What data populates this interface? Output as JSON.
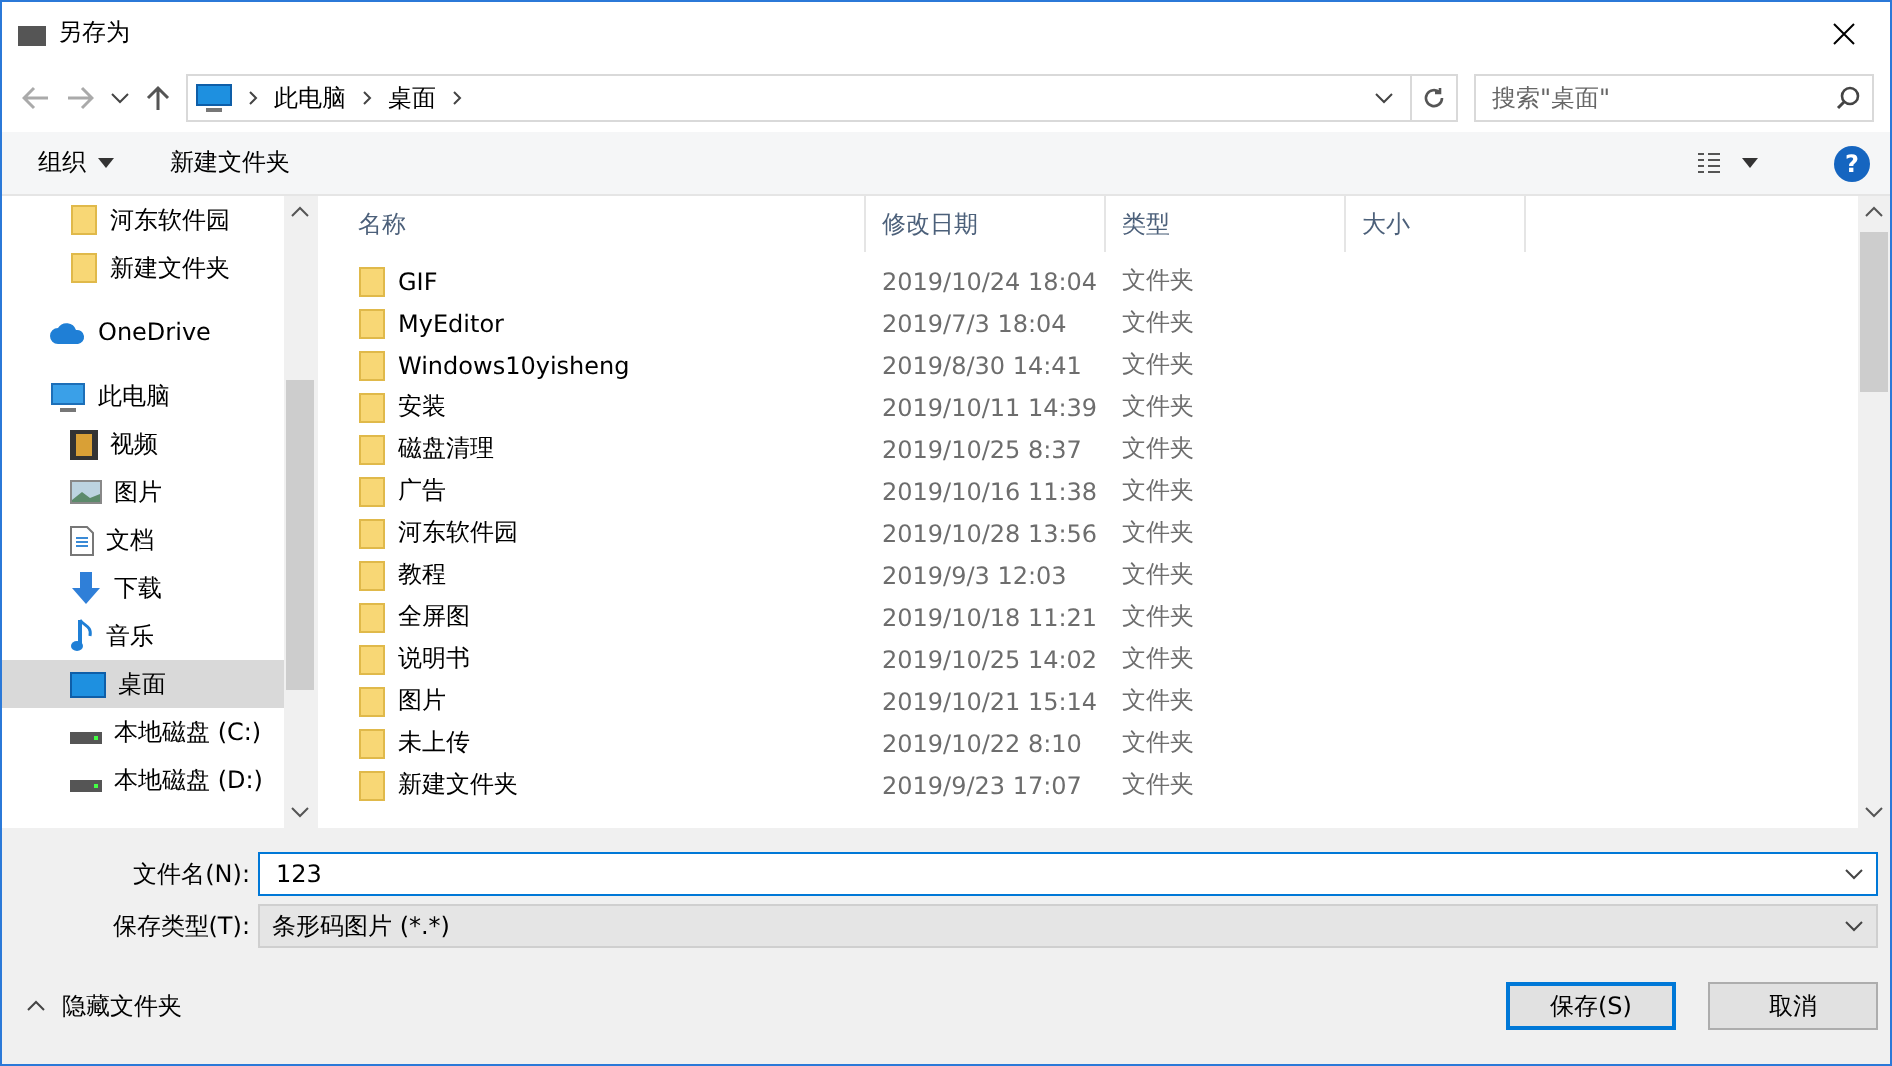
{
  "window": {
    "title": "另存为"
  },
  "address": {
    "path": [
      "此电脑",
      "桌面"
    ],
    "search_placeholder": "搜索\"桌面\""
  },
  "toolbar": {
    "organize": "组织",
    "new_folder": "新建文件夹",
    "help": "?"
  },
  "sidebar": {
    "items": [
      {
        "label": "河东软件园",
        "kind": "folder",
        "selected": false
      },
      {
        "label": "新建文件夹",
        "kind": "folder",
        "selected": false
      },
      {
        "label": "OneDrive",
        "kind": "cloud",
        "selected": false
      },
      {
        "label": "此电脑",
        "kind": "pc",
        "selected": false
      },
      {
        "label": "视频",
        "kind": "video",
        "selected": false
      },
      {
        "label": "图片",
        "kind": "picture",
        "selected": false
      },
      {
        "label": "文档",
        "kind": "document",
        "selected": false
      },
      {
        "label": "下载",
        "kind": "download",
        "selected": false
      },
      {
        "label": "音乐",
        "kind": "music",
        "selected": false
      },
      {
        "label": "桌面",
        "kind": "desktop",
        "selected": true
      },
      {
        "label": "本地磁盘 (C:)",
        "kind": "drive",
        "selected": false
      },
      {
        "label": "本地磁盘 (D:)",
        "kind": "drive",
        "selected": false
      }
    ]
  },
  "table": {
    "columns": [
      "名称",
      "修改日期",
      "类型",
      "大小"
    ],
    "rows": [
      [
        "GIF",
        "2019/10/24 18:04",
        "文件夹"
      ],
      [
        "MyEditor",
        "2019/7/3 18:04",
        "文件夹"
      ],
      [
        "Windows10yisheng",
        "2019/8/30 14:41",
        "文件夹"
      ],
      [
        "安装",
        "2019/10/11 14:39",
        "文件夹"
      ],
      [
        "磁盘清理",
        "2019/10/25 8:37",
        "文件夹"
      ],
      [
        "广告",
        "2019/10/16 11:38",
        "文件夹"
      ],
      [
        "河东软件园",
        "2019/10/28 13:56",
        "文件夹"
      ],
      [
        "教程",
        "2019/9/3 12:03",
        "文件夹"
      ],
      [
        "全屏图",
        "2019/10/18 11:21",
        "文件夹"
      ],
      [
        "说明书",
        "2019/10/25 14:02",
        "文件夹"
      ],
      [
        "图片",
        "2019/10/21 15:14",
        "文件夹"
      ],
      [
        "未上传",
        "2019/10/22 8:10",
        "文件夹"
      ],
      [
        "新建文件夹",
        "2019/9/23 17:07",
        "文件夹"
      ]
    ]
  },
  "form": {
    "filename_label": "文件名(N):",
    "filename": "123",
    "type_label": "保存类型(T):",
    "type": "条形码图片 (*.*)"
  },
  "footer": {
    "hide_folders": "隐藏文件夹",
    "save": "保存(S)",
    "cancel": "取消"
  }
}
